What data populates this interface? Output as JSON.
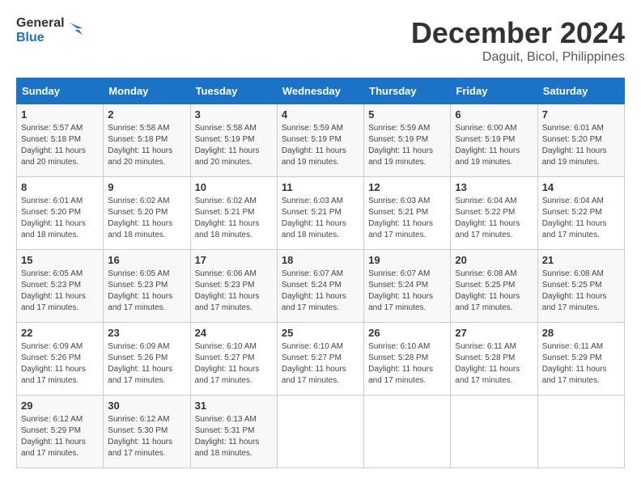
{
  "logo": {
    "text_general": "General",
    "text_blue": "Blue"
  },
  "header": {
    "month": "December 2024",
    "location": "Daguit, Bicol, Philippines"
  },
  "weekdays": [
    "Sunday",
    "Monday",
    "Tuesday",
    "Wednesday",
    "Thursday",
    "Friday",
    "Saturday"
  ],
  "weeks": [
    [
      {
        "day": "1",
        "sunrise": "5:57 AM",
        "sunset": "5:18 PM",
        "daylight": "11 hours and 20 minutes."
      },
      {
        "day": "2",
        "sunrise": "5:58 AM",
        "sunset": "5:18 PM",
        "daylight": "11 hours and 20 minutes."
      },
      {
        "day": "3",
        "sunrise": "5:58 AM",
        "sunset": "5:19 PM",
        "daylight": "11 hours and 20 minutes."
      },
      {
        "day": "4",
        "sunrise": "5:59 AM",
        "sunset": "5:19 PM",
        "daylight": "11 hours and 19 minutes."
      },
      {
        "day": "5",
        "sunrise": "5:59 AM",
        "sunset": "5:19 PM",
        "daylight": "11 hours and 19 minutes."
      },
      {
        "day": "6",
        "sunrise": "6:00 AM",
        "sunset": "5:19 PM",
        "daylight": "11 hours and 19 minutes."
      },
      {
        "day": "7",
        "sunrise": "6:01 AM",
        "sunset": "5:20 PM",
        "daylight": "11 hours and 19 minutes."
      }
    ],
    [
      {
        "day": "8",
        "sunrise": "6:01 AM",
        "sunset": "5:20 PM",
        "daylight": "11 hours and 18 minutes."
      },
      {
        "day": "9",
        "sunrise": "6:02 AM",
        "sunset": "5:20 PM",
        "daylight": "11 hours and 18 minutes."
      },
      {
        "day": "10",
        "sunrise": "6:02 AM",
        "sunset": "5:21 PM",
        "daylight": "11 hours and 18 minutes."
      },
      {
        "day": "11",
        "sunrise": "6:03 AM",
        "sunset": "5:21 PM",
        "daylight": "11 hours and 18 minutes."
      },
      {
        "day": "12",
        "sunrise": "6:03 AM",
        "sunset": "5:21 PM",
        "daylight": "11 hours and 17 minutes."
      },
      {
        "day": "13",
        "sunrise": "6:04 AM",
        "sunset": "5:22 PM",
        "daylight": "11 hours and 17 minutes."
      },
      {
        "day": "14",
        "sunrise": "6:04 AM",
        "sunset": "5:22 PM",
        "daylight": "11 hours and 17 minutes."
      }
    ],
    [
      {
        "day": "15",
        "sunrise": "6:05 AM",
        "sunset": "5:23 PM",
        "daylight": "11 hours and 17 minutes."
      },
      {
        "day": "16",
        "sunrise": "6:05 AM",
        "sunset": "5:23 PM",
        "daylight": "11 hours and 17 minutes."
      },
      {
        "day": "17",
        "sunrise": "6:06 AM",
        "sunset": "5:23 PM",
        "daylight": "11 hours and 17 minutes."
      },
      {
        "day": "18",
        "sunrise": "6:07 AM",
        "sunset": "5:24 PM",
        "daylight": "11 hours and 17 minutes."
      },
      {
        "day": "19",
        "sunrise": "6:07 AM",
        "sunset": "5:24 PM",
        "daylight": "11 hours and 17 minutes."
      },
      {
        "day": "20",
        "sunrise": "6:08 AM",
        "sunset": "5:25 PM",
        "daylight": "11 hours and 17 minutes."
      },
      {
        "day": "21",
        "sunrise": "6:08 AM",
        "sunset": "5:25 PM",
        "daylight": "11 hours and 17 minutes."
      }
    ],
    [
      {
        "day": "22",
        "sunrise": "6:09 AM",
        "sunset": "5:26 PM",
        "daylight": "11 hours and 17 minutes."
      },
      {
        "day": "23",
        "sunrise": "6:09 AM",
        "sunset": "5:26 PM",
        "daylight": "11 hours and 17 minutes."
      },
      {
        "day": "24",
        "sunrise": "6:10 AM",
        "sunset": "5:27 PM",
        "daylight": "11 hours and 17 minutes."
      },
      {
        "day": "25",
        "sunrise": "6:10 AM",
        "sunset": "5:27 PM",
        "daylight": "11 hours and 17 minutes."
      },
      {
        "day": "26",
        "sunrise": "6:10 AM",
        "sunset": "5:28 PM",
        "daylight": "11 hours and 17 minutes."
      },
      {
        "day": "27",
        "sunrise": "6:11 AM",
        "sunset": "5:28 PM",
        "daylight": "11 hours and 17 minutes."
      },
      {
        "day": "28",
        "sunrise": "6:11 AM",
        "sunset": "5:29 PM",
        "daylight": "11 hours and 17 minutes."
      }
    ],
    [
      {
        "day": "29",
        "sunrise": "6:12 AM",
        "sunset": "5:29 PM",
        "daylight": "11 hours and 17 minutes."
      },
      {
        "day": "30",
        "sunrise": "6:12 AM",
        "sunset": "5:30 PM",
        "daylight": "11 hours and 17 minutes."
      },
      {
        "day": "31",
        "sunrise": "6:13 AM",
        "sunset": "5:31 PM",
        "daylight": "11 hours and 18 minutes."
      },
      null,
      null,
      null,
      null
    ]
  ]
}
